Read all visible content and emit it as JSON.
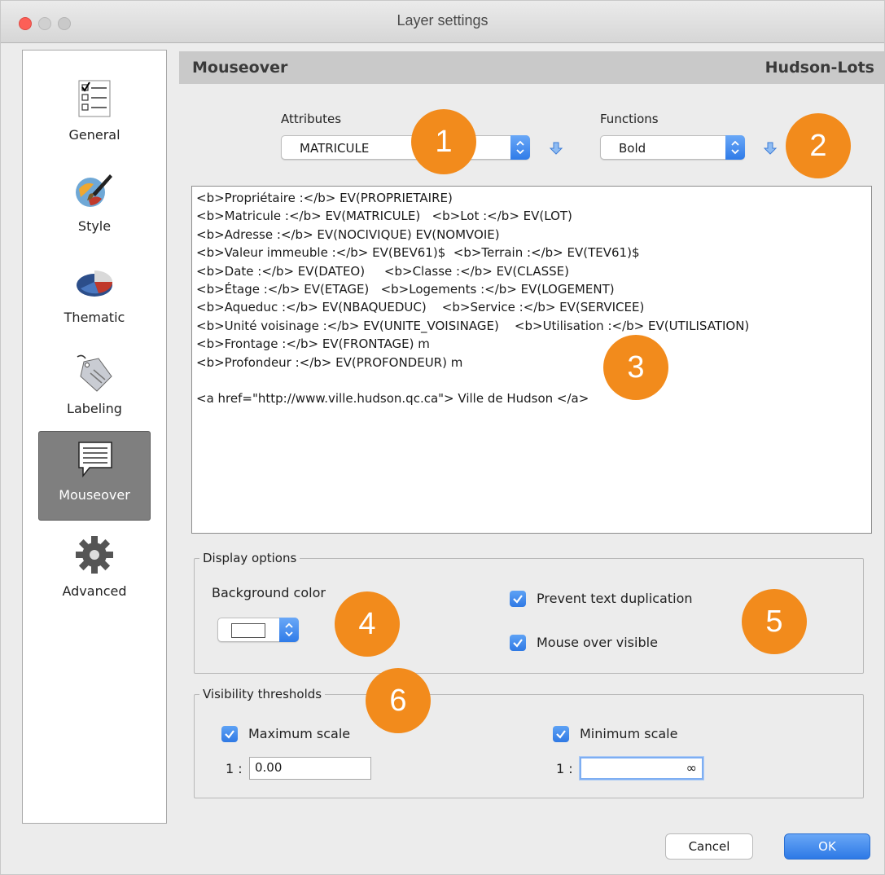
{
  "window": {
    "title": "Layer settings"
  },
  "sidebar": {
    "items": [
      {
        "label": "General",
        "icon": "checklist-icon"
      },
      {
        "label": "Style",
        "icon": "style-brush-icon"
      },
      {
        "label": "Thematic",
        "icon": "pie-chart-icon"
      },
      {
        "label": "Labeling",
        "icon": "tag-icon"
      },
      {
        "label": "Mouseover",
        "icon": "speech-bubble-icon",
        "active": true
      },
      {
        "label": "Advanced",
        "icon": "gear-icon"
      }
    ]
  },
  "header": {
    "section": "Mouseover",
    "layer": "Hudson-Lots"
  },
  "attributes": {
    "label": "Attributes",
    "value": "MATRICULE"
  },
  "functions": {
    "label": "Functions",
    "value": "Bold"
  },
  "editor": {
    "lines": [
      "<b>Propriétaire :</b> EV(PROPRIETAIRE)",
      "<b>Matricule :</b> EV(MATRICULE)   <b>Lot :</b> EV(LOT)",
      "<b>Adresse :</b> EV(NOCIVIQUE) EV(NOMVOIE)",
      "<b>Valeur immeuble :</b> EV(BEV61)$  <b>Terrain :</b> EV(TEV61)$",
      "<b>Date :</b> EV(DATEO)     <b>Classe :</b> EV(CLASSE)",
      "<b>Étage :</b> EV(ETAGE)   <b>Logements :</b> EV(LOGEMENT)",
      "<b>Aqueduc :</b> EV(NBAQUEDUC)    <b>Service :</b> EV(SERVICEE)",
      "<b>Unité voisinage :</b> EV(UNITE_VOISINAGE)    <b>Utilisation :</b> EV(UTILISATION)",
      "<b>Frontage :</b> EV(FRONTAGE) m",
      "<b>Profondeur :</b> EV(PROFONDEUR) m",
      "",
      "<a href=\"http://www.ville.hudson.qc.ca\"> Ville de Hudson </a>"
    ]
  },
  "display_options": {
    "title": "Display options",
    "background_color_label": "Background color",
    "background_color": "#ffffff",
    "prevent_duplication": {
      "label": "Prevent text duplication",
      "checked": true
    },
    "mouse_over_visible": {
      "label": "Mouse over visible",
      "checked": true
    }
  },
  "visibility": {
    "title": "Visibility thresholds",
    "max_scale": {
      "label": "Maximum scale",
      "checked": true,
      "prefix": "1 :",
      "value": "0.00"
    },
    "min_scale": {
      "label": "Minimum scale",
      "checked": true,
      "prefix": "1 :",
      "value": "",
      "infinity": "∞"
    }
  },
  "callouts": [
    "1",
    "2",
    "3",
    "4",
    "5",
    "6"
  ],
  "buttons": {
    "cancel": "Cancel",
    "ok": "OK"
  },
  "colors": {
    "accent": "#2f7be8",
    "callout": "#f28b1c",
    "header": "#c9c9c9",
    "active_item": "#7f7f7f"
  }
}
